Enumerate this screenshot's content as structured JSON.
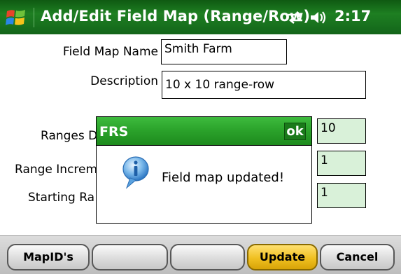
{
  "titlebar": {
    "title": "Add/Edit Field Map (Range/Row)",
    "time": "2:17",
    "icons": [
      "windows-start-icon",
      "sync-arrows-icon",
      "volume-icon"
    ]
  },
  "form": {
    "field_map_name_label": "Field Map Name",
    "field_map_name_value": "Smith Farm",
    "description_label": "Description",
    "description_value": "10 x 10 range-row",
    "ranges_label_visible": "Ranges D",
    "ranges_value": "10",
    "range_increment_label_visible": "Range Increm",
    "range_increment_value": "1",
    "starting_label_visible": "Starting Ra",
    "starting_value": "1"
  },
  "dialog": {
    "title": "FRS",
    "ok_label": "ok",
    "message": "Field map updated!",
    "icon": "info-icon"
  },
  "toolbar": {
    "mapids_label": "MapID's",
    "blank1_label": "",
    "blank2_label": "",
    "update_label": "Update",
    "cancel_label": "Cancel"
  },
  "colors": {
    "titlebar_green": "#1e7f22",
    "dialog_header_green": "#2aa12a",
    "field_highlight": "#d9f1d9",
    "update_button": "#f0c021"
  }
}
